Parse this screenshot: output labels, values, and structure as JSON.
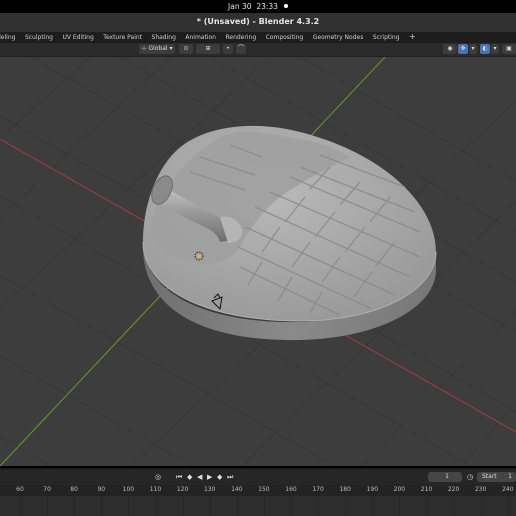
{
  "system": {
    "date": "Jan 30",
    "time": "23:33"
  },
  "window": {
    "title": "* (Unsaved) - Blender 4.3.2"
  },
  "workspaces": [
    "deling",
    "Sculpting",
    "UV Editing",
    "Texture Paint",
    "Shading",
    "Animation",
    "Rendering",
    "Compositing",
    "Geometry Nodes",
    "Scripting",
    "+"
  ],
  "viewport_header": {
    "transform_orientation": "Global"
  },
  "timeline": {
    "current_frame": "1",
    "start_label": "Start",
    "start_value": "1",
    "ruler_ticks": [
      "60",
      "70",
      "80",
      "90",
      "100",
      "110",
      "120",
      "130",
      "140",
      "150",
      "160",
      "170",
      "180",
      "190",
      "200",
      "210",
      "220",
      "230",
      "240"
    ]
  },
  "colors": {
    "accent": "#4772b3",
    "grid_x_axis": "#a83a44",
    "grid_y_axis": "#6b9a2a",
    "background": "#3d3d3d",
    "model": "#a8a8a8"
  },
  "icons": [
    "object-origin-icon",
    "light-icon",
    "camera-icon",
    "jump-start-icon",
    "play-icon",
    "jump-end-icon",
    "clock-icon"
  ]
}
